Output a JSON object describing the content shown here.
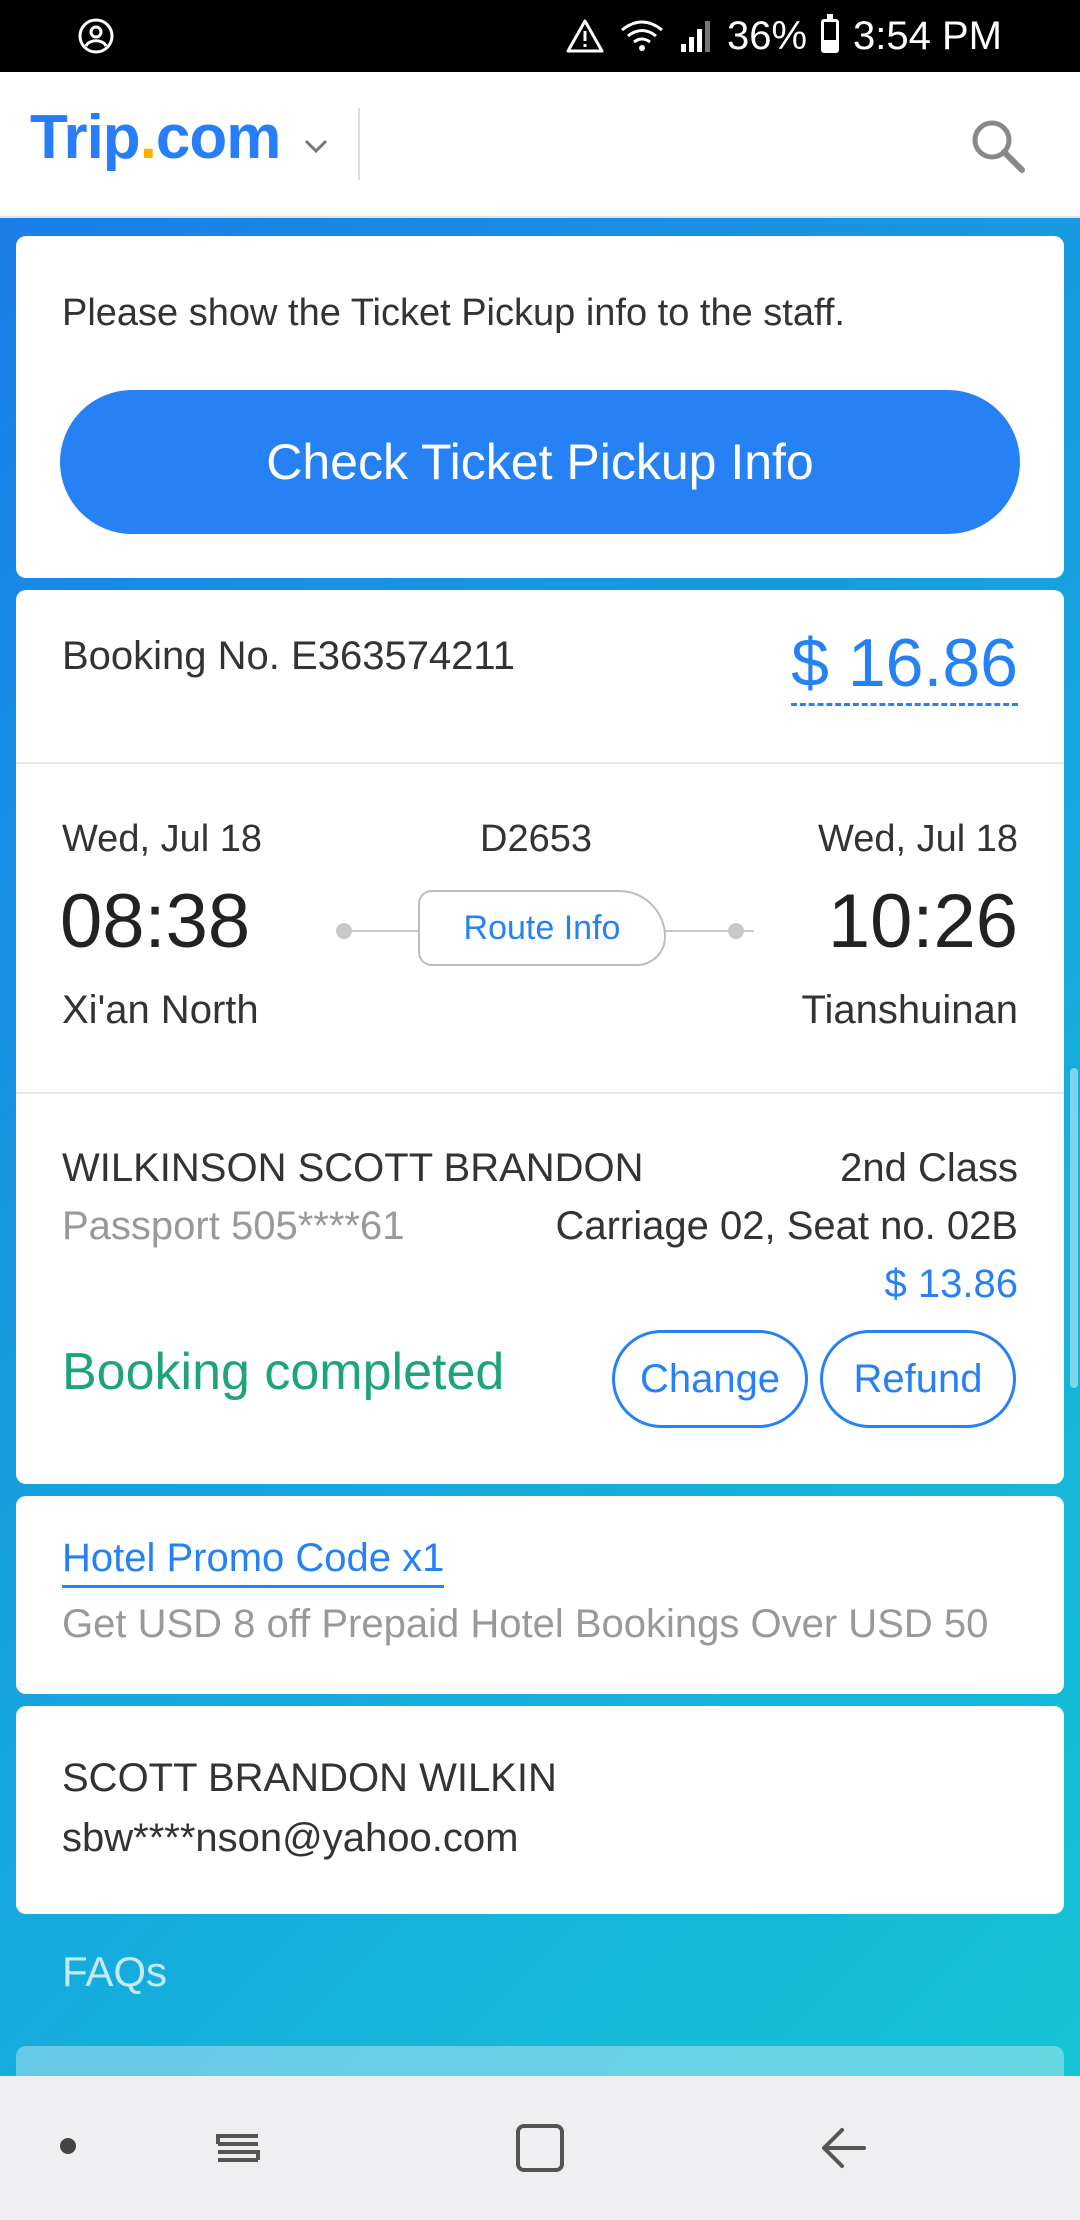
{
  "status_bar": {
    "battery_percent": "36%",
    "time": "3:54 PM",
    "battery_level": 0.36,
    "icons": [
      "account-circle-icon",
      "warning-icon",
      "wifi-icon",
      "signal-icon",
      "battery-icon"
    ]
  },
  "header": {
    "logo_main": "Trip",
    "logo_dot": ".",
    "logo_tld": "com",
    "icons": [
      "chevron-down-icon",
      "search-icon"
    ]
  },
  "pickup": {
    "instruction": "Please show the Ticket Pickup info to the staff.",
    "button_label": "Check Ticket Pickup Info"
  },
  "booking": {
    "booking_no": "Booking No. E363574211",
    "total_price": "$ 16.86",
    "train_no": "D2653",
    "departure": {
      "date": "Wed, Jul 18",
      "time": "08:38",
      "station": "Xi'an North"
    },
    "arrival": {
      "date": "Wed, Jul 18",
      "time": "10:26",
      "station": "Tianshuinan"
    },
    "route_info_label": "Route Info",
    "passenger": {
      "name": "WILKINSON SCOTT BRANDON",
      "passport": "Passport 505****61",
      "seat_class": "2nd Class",
      "seat": "Carriage 02, Seat no. 02B",
      "price": "$ 13.86"
    },
    "status": "Booking completed",
    "change_label": "Change",
    "refund_label": "Refund"
  },
  "promo": {
    "link": "Hotel Promo Code x1",
    "description": "Get USD 8 off Prepaid Hotel Bookings Over USD 50"
  },
  "contact": {
    "name": "SCOTT BRANDON WILKIN",
    "email": "sbw****nson@yahoo.com"
  },
  "faqs_label": "FAQs",
  "nav_bar": {
    "icons": [
      "dot-icon",
      "recent-apps-icon",
      "home-icon",
      "back-icon"
    ]
  },
  "colors": {
    "brand_blue": "#287dfa",
    "logo_dot": "#ffb000",
    "accent_blue": "#2681f5",
    "success_green": "#1fa37a"
  }
}
